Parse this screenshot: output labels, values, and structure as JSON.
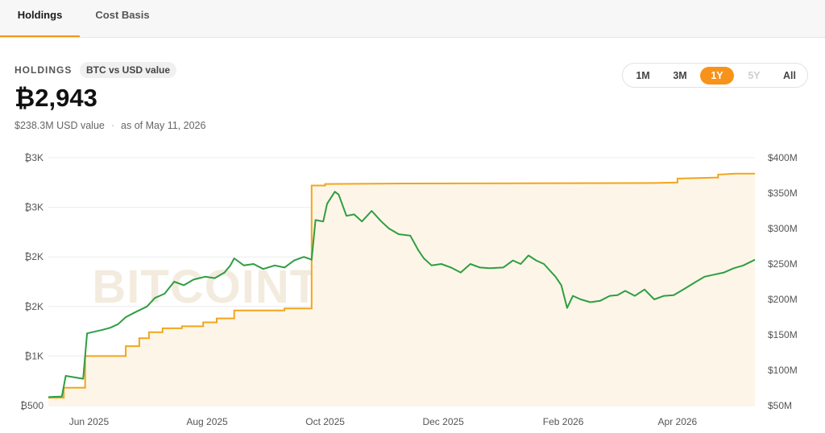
{
  "tabs": [
    {
      "label": "Holdings",
      "active": true
    },
    {
      "label": "Cost Basis",
      "active": false
    }
  ],
  "header": {
    "label": "HOLDINGS",
    "pill": "BTC vs USD value",
    "value": "₿2,943",
    "usd_value": "$238.3M USD value",
    "as_of": "as of May 11, 2026"
  },
  "ranges": [
    {
      "label": "1M",
      "state": "normal"
    },
    {
      "label": "3M",
      "state": "normal"
    },
    {
      "label": "1Y",
      "state": "active"
    },
    {
      "label": "5Y",
      "state": "disabled"
    },
    {
      "label": "All",
      "state": "normal"
    }
  ],
  "watermark": "BITCOINTREASURIES.NET",
  "colors": {
    "accent": "#f7931a",
    "btc_line": "#f2a51c",
    "usd_line": "#2e9e43",
    "area_fill": "#fdf6e8"
  },
  "chart_data": {
    "type": "line",
    "x_domain": [
      "2025-05-11",
      "2026-05-11"
    ],
    "y_left": {
      "range": [
        500,
        3000
      ],
      "ticks": [
        500,
        1000,
        1500,
        2000,
        2500,
        3000
      ],
      "tick_labels": [
        "₿500",
        "₿1K",
        "₿2K",
        "₿2K",
        "₿3K",
        "₿3K"
      ]
    },
    "y_right": {
      "range": [
        50,
        400
      ],
      "ticks": [
        50,
        100,
        150,
        200,
        250,
        300,
        350,
        400
      ],
      "tick_labels": [
        "$50M",
        "$100M",
        "$150M",
        "$200M",
        "$250M",
        "$300M",
        "$350M",
        "$400M"
      ]
    },
    "x_ticks": [
      {
        "date": "2025-06-01",
        "label": "Jun 2025"
      },
      {
        "date": "2025-08-01",
        "label": "Aug 2025"
      },
      {
        "date": "2025-10-01",
        "label": "Oct 2025"
      },
      {
        "date": "2025-12-01",
        "label": "Dec 2025"
      },
      {
        "date": "2026-02-01",
        "label": "Feb 2026"
      },
      {
        "date": "2026-04-01",
        "label": "Apr 2026"
      }
    ],
    "grid": true,
    "series": [
      {
        "axis": "left",
        "step": true,
        "fill": true,
        "points": [
          [
            "2025-05-11",
            580
          ],
          [
            "2025-05-19",
            580
          ],
          [
            "2025-05-19",
            680
          ],
          [
            "2025-05-30",
            680
          ],
          [
            "2025-05-30",
            1000
          ],
          [
            "2025-06-20",
            1000
          ],
          [
            "2025-06-20",
            1100
          ],
          [
            "2025-06-27",
            1100
          ],
          [
            "2025-06-27",
            1180
          ],
          [
            "2025-07-02",
            1180
          ],
          [
            "2025-07-02",
            1240
          ],
          [
            "2025-07-09",
            1240
          ],
          [
            "2025-07-09",
            1280
          ],
          [
            "2025-07-19",
            1280
          ],
          [
            "2025-07-19",
            1300
          ],
          [
            "2025-07-30",
            1300
          ],
          [
            "2025-07-30",
            1340
          ],
          [
            "2025-08-06",
            1340
          ],
          [
            "2025-08-06",
            1380
          ],
          [
            "2025-08-15",
            1380
          ],
          [
            "2025-08-15",
            1460
          ],
          [
            "2025-09-10",
            1460
          ],
          [
            "2025-09-10",
            1480
          ],
          [
            "2025-09-24",
            1480
          ],
          [
            "2025-09-24",
            2720
          ],
          [
            "2025-10-01",
            2720
          ],
          [
            "2025-10-01",
            2735
          ],
          [
            "2025-11-10",
            2740
          ],
          [
            "2026-03-20",
            2745
          ],
          [
            "2026-04-01",
            2750
          ],
          [
            "2026-04-01",
            2790
          ],
          [
            "2026-04-22",
            2800
          ],
          [
            "2026-04-22",
            2830
          ],
          [
            "2026-05-01",
            2840
          ],
          [
            "2026-05-11",
            2840
          ]
        ]
      },
      {
        "axis": "right",
        "step": false,
        "fill": false,
        "points": [
          [
            "2025-05-11",
            62
          ],
          [
            "2025-05-18",
            63
          ],
          [
            "2025-05-20",
            92
          ],
          [
            "2025-05-29",
            88
          ],
          [
            "2025-05-31",
            152
          ],
          [
            "2025-06-08",
            157
          ],
          [
            "2025-06-12",
            160
          ],
          [
            "2025-06-16",
            165
          ],
          [
            "2025-06-20",
            175
          ],
          [
            "2025-06-25",
            182
          ],
          [
            "2025-07-01",
            190
          ],
          [
            "2025-07-05",
            202
          ],
          [
            "2025-07-10",
            208
          ],
          [
            "2025-07-15",
            225
          ],
          [
            "2025-07-20",
            220
          ],
          [
            "2025-07-25",
            228
          ],
          [
            "2025-07-31",
            232
          ],
          [
            "2025-08-05",
            230
          ],
          [
            "2025-08-10",
            238
          ],
          [
            "2025-08-13",
            248
          ],
          [
            "2025-08-15",
            258
          ],
          [
            "2025-08-20",
            248
          ],
          [
            "2025-08-25",
            250
          ],
          [
            "2025-08-30",
            243
          ],
          [
            "2025-09-05",
            248
          ],
          [
            "2025-09-10",
            245
          ],
          [
            "2025-09-15",
            255
          ],
          [
            "2025-09-20",
            260
          ],
          [
            "2025-09-24",
            256
          ],
          [
            "2025-09-26",
            312
          ],
          [
            "2025-09-30",
            310
          ],
          [
            "2025-10-02",
            335
          ],
          [
            "2025-10-06",
            352
          ],
          [
            "2025-10-08",
            348
          ],
          [
            "2025-10-12",
            318
          ],
          [
            "2025-10-16",
            320
          ],
          [
            "2025-10-20",
            310
          ],
          [
            "2025-10-25",
            325
          ],
          [
            "2025-10-30",
            310
          ],
          [
            "2025-11-03",
            300
          ],
          [
            "2025-11-08",
            292
          ],
          [
            "2025-11-14",
            290
          ],
          [
            "2025-11-18",
            270
          ],
          [
            "2025-11-21",
            258
          ],
          [
            "2025-11-25",
            248
          ],
          [
            "2025-11-30",
            250
          ],
          [
            "2025-12-05",
            245
          ],
          [
            "2025-12-10",
            238
          ],
          [
            "2025-12-15",
            250
          ],
          [
            "2025-12-20",
            245
          ],
          [
            "2025-12-25",
            244
          ],
          [
            "2026-01-01",
            245
          ],
          [
            "2026-01-06",
            255
          ],
          [
            "2026-01-10",
            250
          ],
          [
            "2026-01-14",
            262
          ],
          [
            "2026-01-18",
            255
          ],
          [
            "2026-01-22",
            250
          ],
          [
            "2026-01-28",
            232
          ],
          [
            "2026-01-31",
            220
          ],
          [
            "2026-02-03",
            188
          ],
          [
            "2026-02-06",
            205
          ],
          [
            "2026-02-10",
            200
          ],
          [
            "2026-02-15",
            196
          ],
          [
            "2026-02-20",
            198
          ],
          [
            "2026-02-25",
            205
          ],
          [
            "2026-03-01",
            206
          ],
          [
            "2026-03-05",
            212
          ],
          [
            "2026-03-10",
            205
          ],
          [
            "2026-03-15",
            214
          ],
          [
            "2026-03-20",
            200
          ],
          [
            "2026-03-25",
            205
          ],
          [
            "2026-03-30",
            206
          ],
          [
            "2026-04-04",
            214
          ],
          [
            "2026-04-10",
            224
          ],
          [
            "2026-04-15",
            232
          ],
          [
            "2026-04-20",
            235
          ],
          [
            "2026-04-25",
            238
          ],
          [
            "2026-04-30",
            244
          ],
          [
            "2026-05-05",
            248
          ],
          [
            "2026-05-11",
            256
          ]
        ]
      }
    ]
  }
}
